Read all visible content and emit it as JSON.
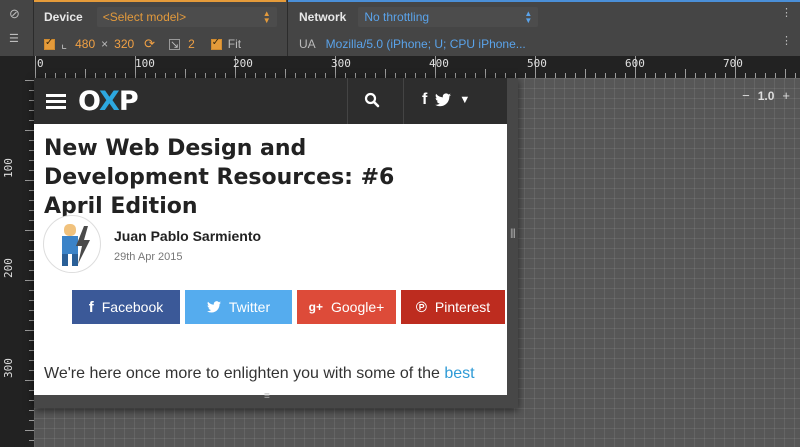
{
  "toolbar": {
    "device_label": "Device",
    "model_select": "<Select model>",
    "network_label": "Network",
    "network_select": "No throttling",
    "width": "480",
    "times": "×",
    "height": "320",
    "scale": "2",
    "fit_label": "Fit",
    "ua_label": "UA",
    "ua_value": "Mozilla/5.0 (iPhone; U; CPU iPhone..."
  },
  "ruler": {
    "h_labels": [
      "0",
      "100",
      "200",
      "300",
      "400",
      "500",
      "600",
      "700"
    ],
    "v_labels": [
      "100",
      "200",
      "300"
    ]
  },
  "zoom": {
    "minus": "−",
    "value": "1.0",
    "plus": "+"
  },
  "site": {
    "logo_left": "O",
    "logo_x": "X",
    "logo_right": "P",
    "title": "New Web Design and Development Resources: #6 April Edition",
    "author": "Juan Pablo Sarmiento",
    "date": "29th Apr 2015",
    "share": {
      "facebook": "Facebook",
      "twitter": "Twitter",
      "google": "Google+",
      "pinterest": "Pinterest"
    },
    "excerpt_text": "We're here once more to enlighten you with some of the ",
    "excerpt_link": "best"
  },
  "colors": {
    "accent_orange": "#e59b3a",
    "accent_blue": "#4a8fd8",
    "facebook": "#3b5998",
    "twitter": "#55acee",
    "google": "#dd4b39",
    "pinterest": "#bd2c1f"
  }
}
